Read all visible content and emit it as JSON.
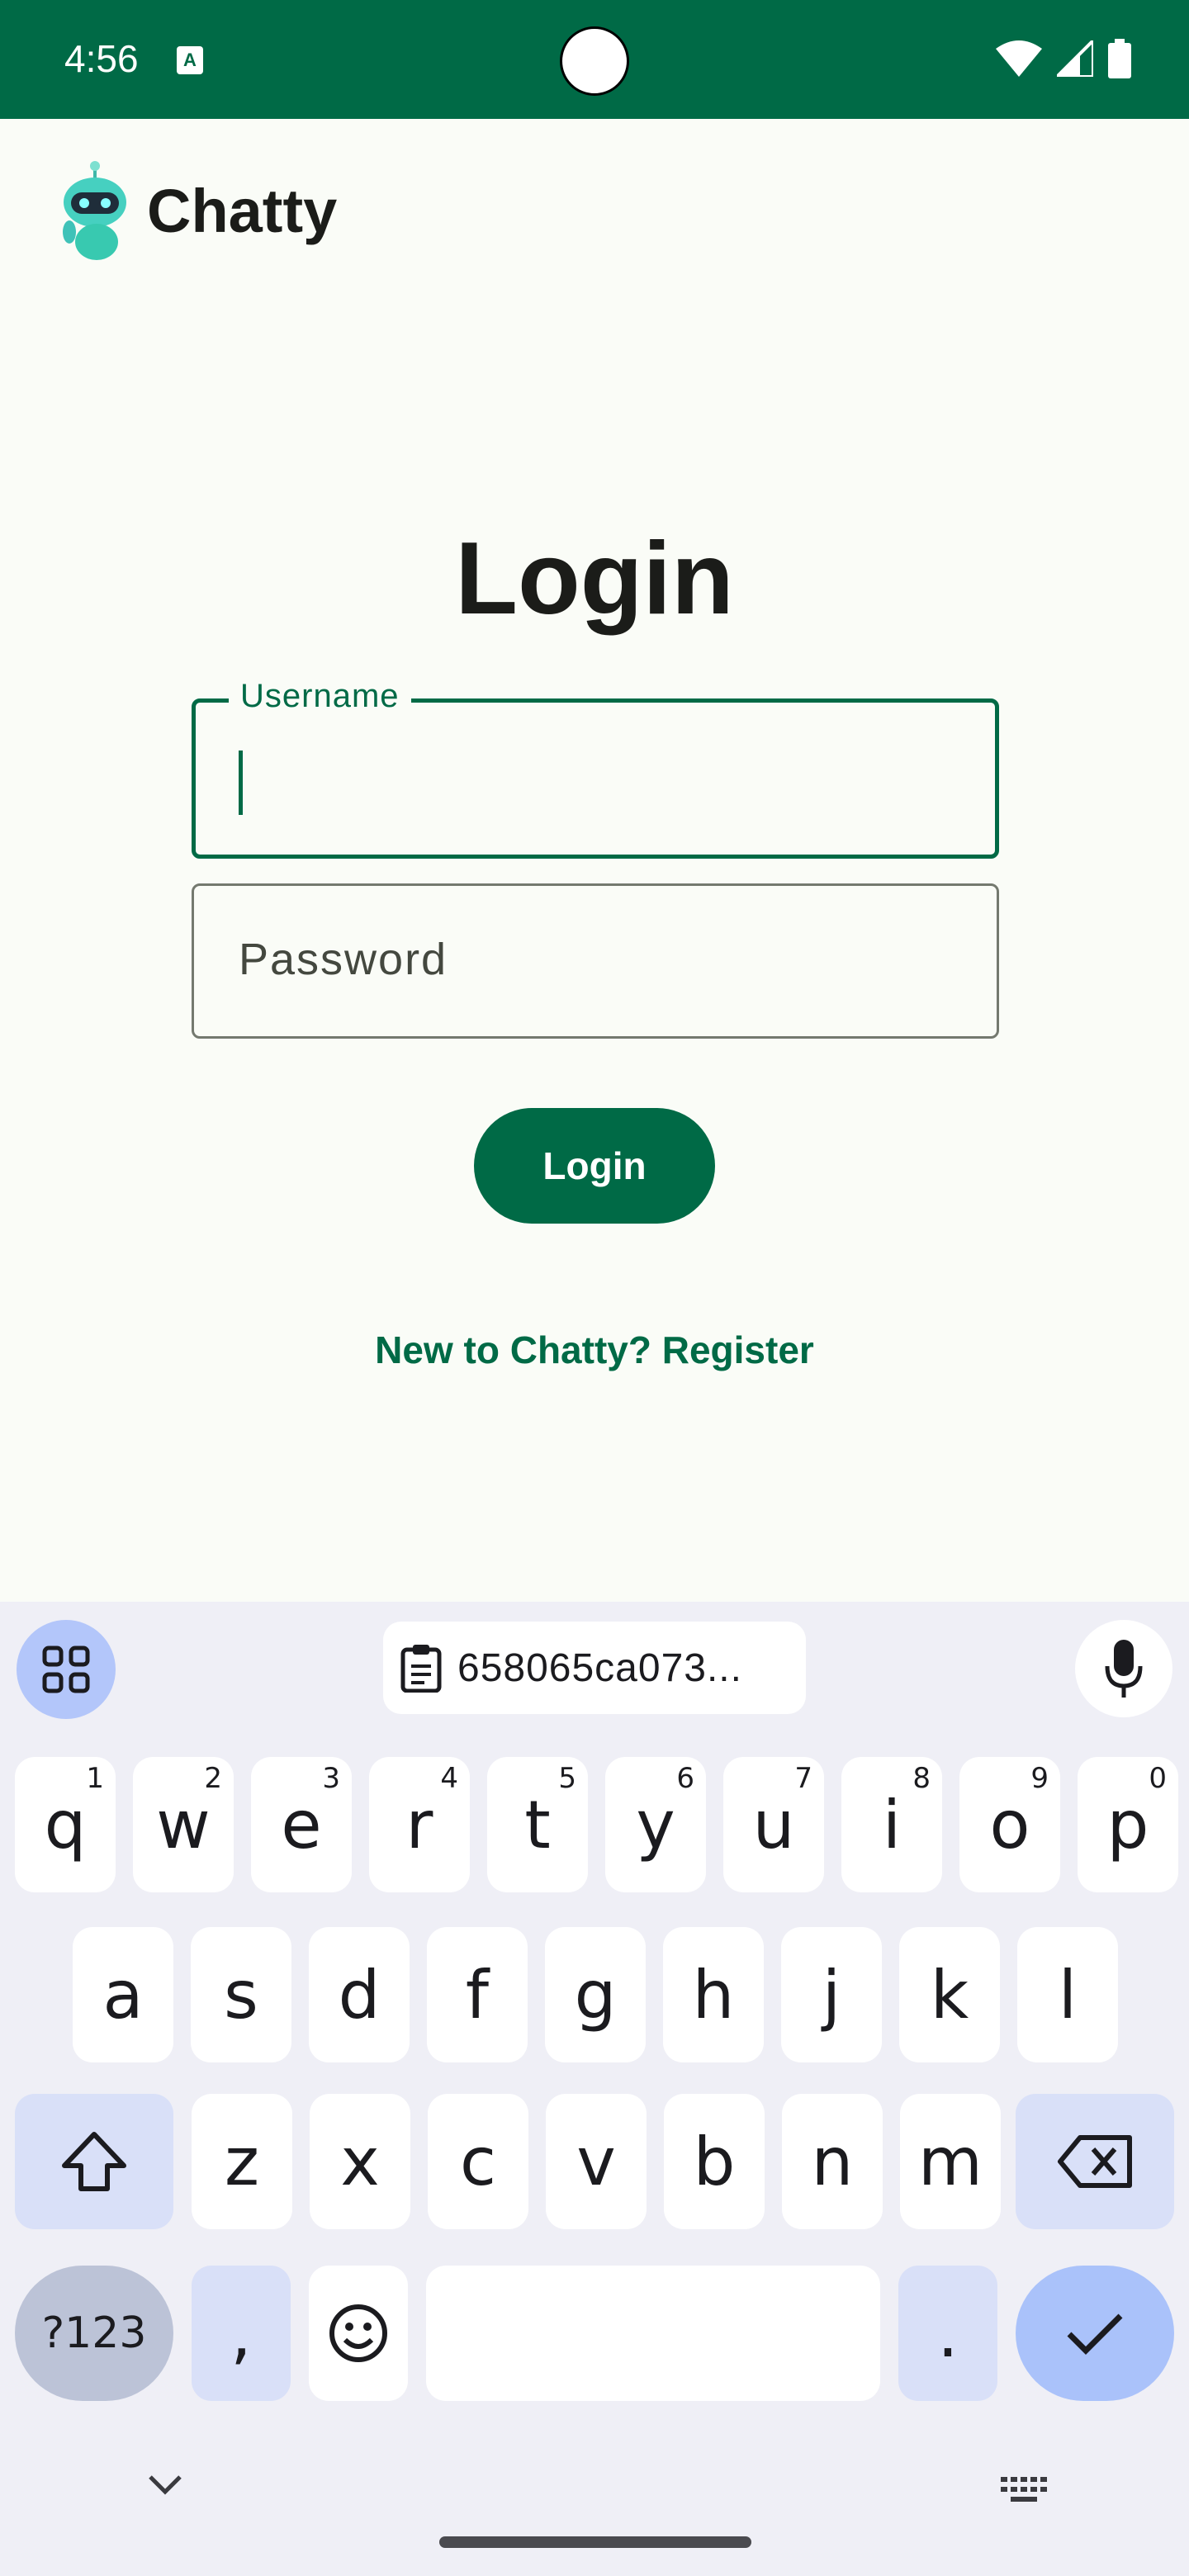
{
  "status_bar": {
    "time": "4:56",
    "notification_icon": "A",
    "icons": [
      "wifi-icon",
      "signal-icon",
      "battery-icon"
    ]
  },
  "app": {
    "name": "Chatty",
    "logo_icon": "robot-mascot-icon"
  },
  "login": {
    "title": "Login",
    "username_label": "Username",
    "username_value": "",
    "password_placeholder": "Password",
    "button_label": "Login",
    "register_link": "New to Chatty? Register"
  },
  "keyboard": {
    "clipboard_text": "658065ca073...",
    "rows": [
      [
        {
          "k": "q",
          "h": "1"
        },
        {
          "k": "w",
          "h": "2"
        },
        {
          "k": "e",
          "h": "3"
        },
        {
          "k": "r",
          "h": "4"
        },
        {
          "k": "t",
          "h": "5"
        },
        {
          "k": "y",
          "h": "6"
        },
        {
          "k": "u",
          "h": "7"
        },
        {
          "k": "i",
          "h": "8"
        },
        {
          "k": "o",
          "h": "9"
        },
        {
          "k": "p",
          "h": "0"
        }
      ],
      [
        {
          "k": "a"
        },
        {
          "k": "s"
        },
        {
          "k": "d"
        },
        {
          "k": "f"
        },
        {
          "k": "g"
        },
        {
          "k": "h"
        },
        {
          "k": "j"
        },
        {
          "k": "k"
        },
        {
          "k": "l"
        }
      ],
      [
        {
          "k": "z"
        },
        {
          "k": "x"
        },
        {
          "k": "c"
        },
        {
          "k": "v"
        },
        {
          "k": "b"
        },
        {
          "k": "n"
        },
        {
          "k": "m"
        }
      ]
    ],
    "symbols_key": "?123",
    "comma_key": ",",
    "period_key": "."
  },
  "colors": {
    "primary": "#006a46",
    "background": "#fafcf7",
    "keyboard_bg": "#efeff6",
    "accent_key": "#aac2fa"
  }
}
